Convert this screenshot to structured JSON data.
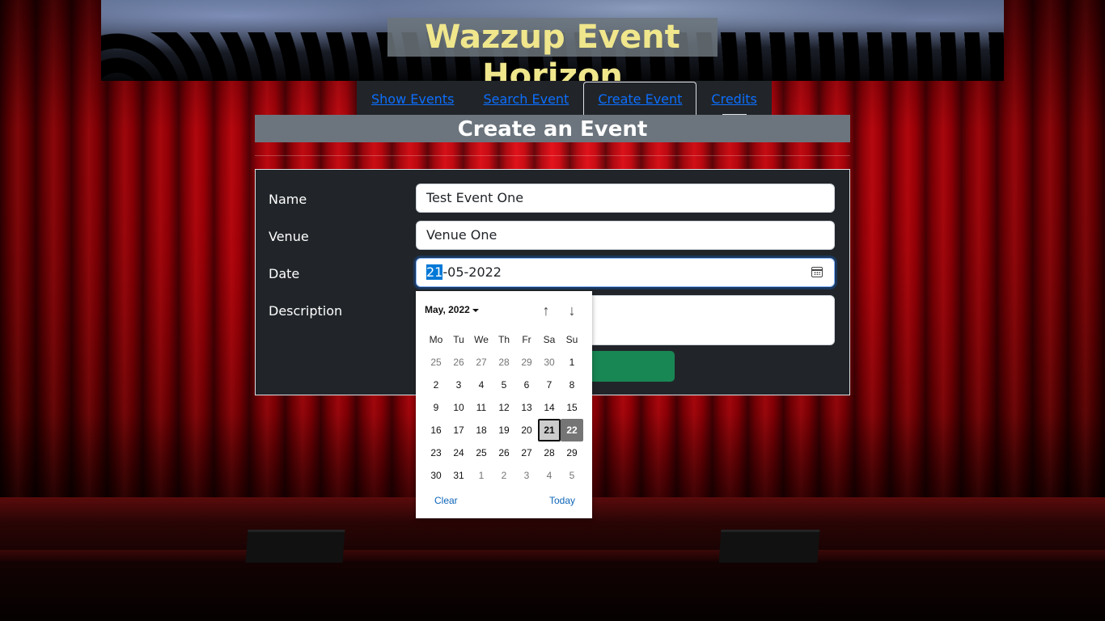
{
  "header": {
    "title": "Wazzup Event Horizon"
  },
  "nav": {
    "tabs": [
      {
        "label": "Show Events"
      },
      {
        "label": "Search Event"
      },
      {
        "label": "Create Event"
      },
      {
        "label": "Credits"
      }
    ],
    "active": "Create Event"
  },
  "page": {
    "heading": "Create an Event"
  },
  "form": {
    "name_label": "Name",
    "name_value": "Test Event One",
    "venue_label": "Venue",
    "venue_value": "Venue One",
    "date_label": "Date",
    "date_day": "21",
    "date_rest": "-05-2022",
    "description_label": "Description",
    "description_value": ""
  },
  "datepicker": {
    "month_label": "May, 2022",
    "weekdays": [
      "Mo",
      "Tu",
      "We",
      "Th",
      "Fr",
      "Sa",
      "Su"
    ],
    "weeks": [
      [
        "25",
        "26",
        "27",
        "28",
        "29",
        "30",
        "1"
      ],
      [
        "2",
        "3",
        "4",
        "5",
        "6",
        "7",
        "8"
      ],
      [
        "9",
        "10",
        "11",
        "12",
        "13",
        "14",
        "15"
      ],
      [
        "16",
        "17",
        "18",
        "19",
        "20",
        "21",
        "22"
      ],
      [
        "23",
        "24",
        "25",
        "26",
        "27",
        "28",
        "29"
      ],
      [
        "30",
        "31",
        "1",
        "2",
        "3",
        "4",
        "5"
      ]
    ],
    "selected": "21",
    "today": "22",
    "clear_label": "Clear",
    "today_label": "Today",
    "up_arrow": "↑",
    "down_arrow": "↓"
  },
  "colors": {
    "title_text": "#f0e68c",
    "link": "#0d6efd",
    "submit_button": "#198754",
    "form_bg": "#212529",
    "heading_bg": "#6c757d"
  }
}
